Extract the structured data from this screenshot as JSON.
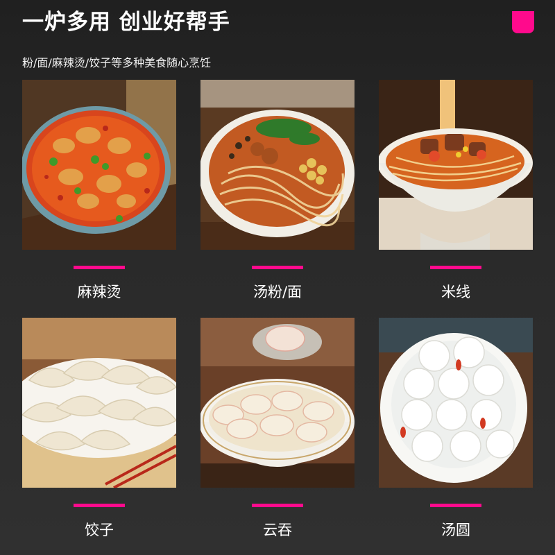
{
  "header": {
    "title": "一炉多用 创业好帮手",
    "subtitle": "粉/面/麻辣烫/饺子等多种美食随心烹饪"
  },
  "colors": {
    "accent": "#ff0a8c",
    "background": "#262626"
  },
  "dishes": [
    {
      "label": "麻辣烫"
    },
    {
      "label": "汤粉/面"
    },
    {
      "label": "米线"
    },
    {
      "label": "饺子"
    },
    {
      "label": "云吞"
    },
    {
      "label": "汤圆"
    }
  ]
}
